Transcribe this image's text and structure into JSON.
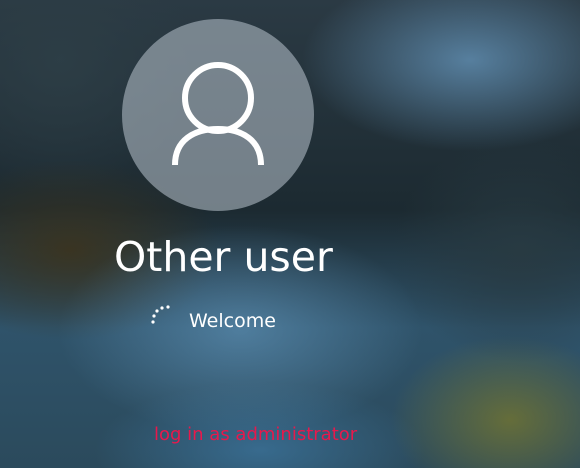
{
  "login": {
    "avatar_icon": "user-silhouette-icon",
    "username": "Other user",
    "spinner_icon": "loading-spinner-icon",
    "status_text": "Welcome"
  },
  "annotation": {
    "text": "log in as administrator",
    "color": "#e8184c"
  },
  "colors": {
    "text": "#ffffff",
    "avatar_circle": "#aab4be"
  }
}
